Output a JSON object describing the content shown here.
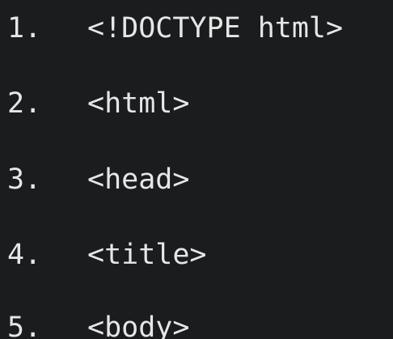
{
  "code_listing": {
    "lines": [
      {
        "number": "1.",
        "text": "<!DOCTYPE html>"
      },
      {
        "number": "2.",
        "text": "<html>"
      },
      {
        "number": "3.",
        "text": "<head>"
      },
      {
        "number": "4.",
        "text": "<title>"
      },
      {
        "number": "5.",
        "text": "<body>"
      }
    ]
  },
  "colors": {
    "background": "#1b1c1e",
    "text": "#e6e6e6"
  }
}
